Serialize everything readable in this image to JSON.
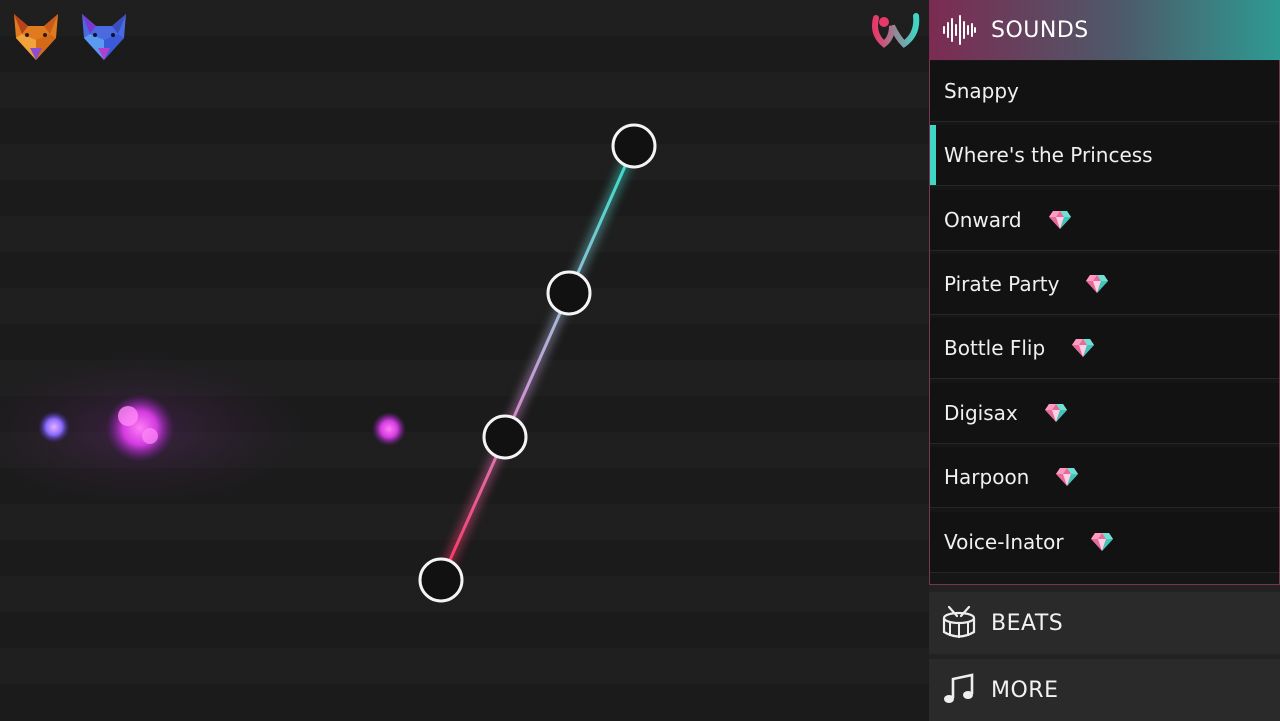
{
  "header": {
    "sounds_label": "SOUNDS"
  },
  "sounds": [
    {
      "label": "Snappy",
      "premium": false,
      "selected": false
    },
    {
      "label": "Where's the Princess",
      "premium": false,
      "selected": true
    },
    {
      "label": "Onward",
      "premium": true,
      "selected": false
    },
    {
      "label": "Pirate Party",
      "premium": true,
      "selected": false
    },
    {
      "label": "Bottle Flip",
      "premium": true,
      "selected": false
    },
    {
      "label": "Digisax",
      "premium": true,
      "selected": false
    },
    {
      "label": "Harpoon",
      "premium": true,
      "selected": false
    },
    {
      "label": "Voice-Inator",
      "premium": true,
      "selected": false
    }
  ],
  "categories": {
    "beats_label": "BEATS",
    "more_label": "MORE"
  },
  "icons": {
    "player1": "orange-fox-icon",
    "player2": "blue-fox-icon",
    "app": "app-logo-icon",
    "header": "sound-wave-icon",
    "premium": "gem-icon",
    "beats": "drum-icon",
    "more": "music-note-icon"
  },
  "colors": {
    "accent_teal": "#3fd6c7",
    "accent_pink": "#e8386a",
    "splat_magenta": "#d944e6"
  }
}
